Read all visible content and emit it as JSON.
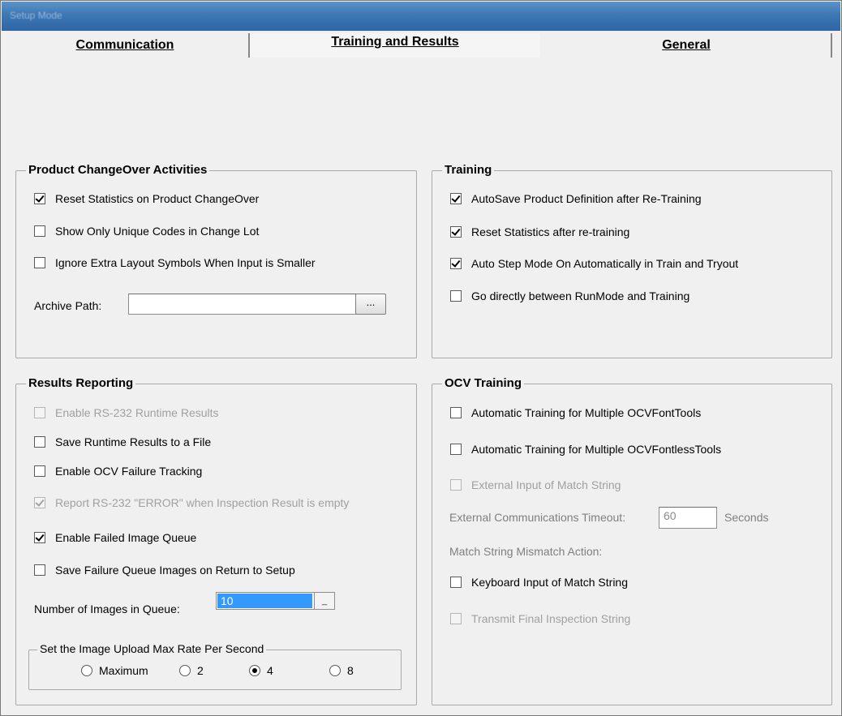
{
  "window": {
    "title": "Setup Mode"
  },
  "tabs": [
    {
      "label": "Communication",
      "active": false
    },
    {
      "label": "Training and Results",
      "active": true
    },
    {
      "label": "General",
      "active": false
    }
  ],
  "product_changeover": {
    "title": "Product ChangeOver Activities",
    "items": [
      {
        "label": "Reset Statistics on Product ChangeOver",
        "checked": true,
        "enabled": true
      },
      {
        "label": "Show Only Unique Codes in Change Lot",
        "checked": false,
        "enabled": true
      },
      {
        "label": "Ignore Extra Layout Symbols When Input is Smaller",
        "checked": false,
        "enabled": true
      }
    ],
    "archive_path_label": "Archive Path:",
    "archive_path_value": "",
    "browse_label": "..."
  },
  "training": {
    "title": "Training",
    "items": [
      {
        "label": "AutoSave Product Definition after Re-Training",
        "checked": true,
        "enabled": true
      },
      {
        "label": "Reset Statistics after re-training",
        "checked": true,
        "enabled": true
      },
      {
        "label": "Auto Step Mode On Automatically in Train and Tryout",
        "checked": true,
        "enabled": true
      },
      {
        "label": "Go directly between RunMode and Training",
        "checked": false,
        "enabled": true
      }
    ]
  },
  "results_reporting": {
    "title": "Results Reporting",
    "items": [
      {
        "label": "Enable RS-232 Runtime Results",
        "checked": false,
        "enabled": false
      },
      {
        "label": "Save Runtime Results to a File",
        "checked": false,
        "enabled": true
      },
      {
        "label": "Enable OCV Failure Tracking",
        "checked": false,
        "enabled": true
      },
      {
        "label": "Report RS-232 \"ERROR\" when Inspection Result is empty",
        "checked": true,
        "enabled": false
      },
      {
        "label": "Enable Failed Image Queue",
        "checked": true,
        "enabled": true
      },
      {
        "label": "Save Failure Queue Images on Return to Setup",
        "checked": false,
        "enabled": true
      }
    ],
    "queue_label": "Number of Images in Queue:",
    "queue_value": "10",
    "upload_rate": {
      "title": "Set the Image Upload Max Rate Per Second",
      "options": [
        {
          "label": "Maximum",
          "selected": false
        },
        {
          "label": "2",
          "selected": false
        },
        {
          "label": "4",
          "selected": true
        },
        {
          "label": "8",
          "selected": false
        }
      ]
    }
  },
  "ocv_training": {
    "title": "OCV Training",
    "items": [
      {
        "label": "Automatic Training for Multiple OCVFontTools",
        "checked": false,
        "enabled": true
      },
      {
        "label": "Automatic Training for Multiple OCVFontlessTools",
        "checked": false,
        "enabled": true
      },
      {
        "label": "External Input of Match String",
        "checked": false,
        "enabled": false
      }
    ],
    "timeout_label": "External Communications Timeout:",
    "timeout_value": "60",
    "timeout_unit": "Seconds",
    "mismatch_label": "Match String Mismatch Action:",
    "mismatch_items": [
      {
        "label": "Keyboard Input of Match String",
        "checked": false,
        "enabled": true
      },
      {
        "label": "Transmit Final Inspection String",
        "checked": false,
        "enabled": false
      }
    ]
  },
  "colors": {
    "titlebar": "#3d77b4",
    "selection": "#3399ff",
    "background": "#f0f0f0"
  }
}
